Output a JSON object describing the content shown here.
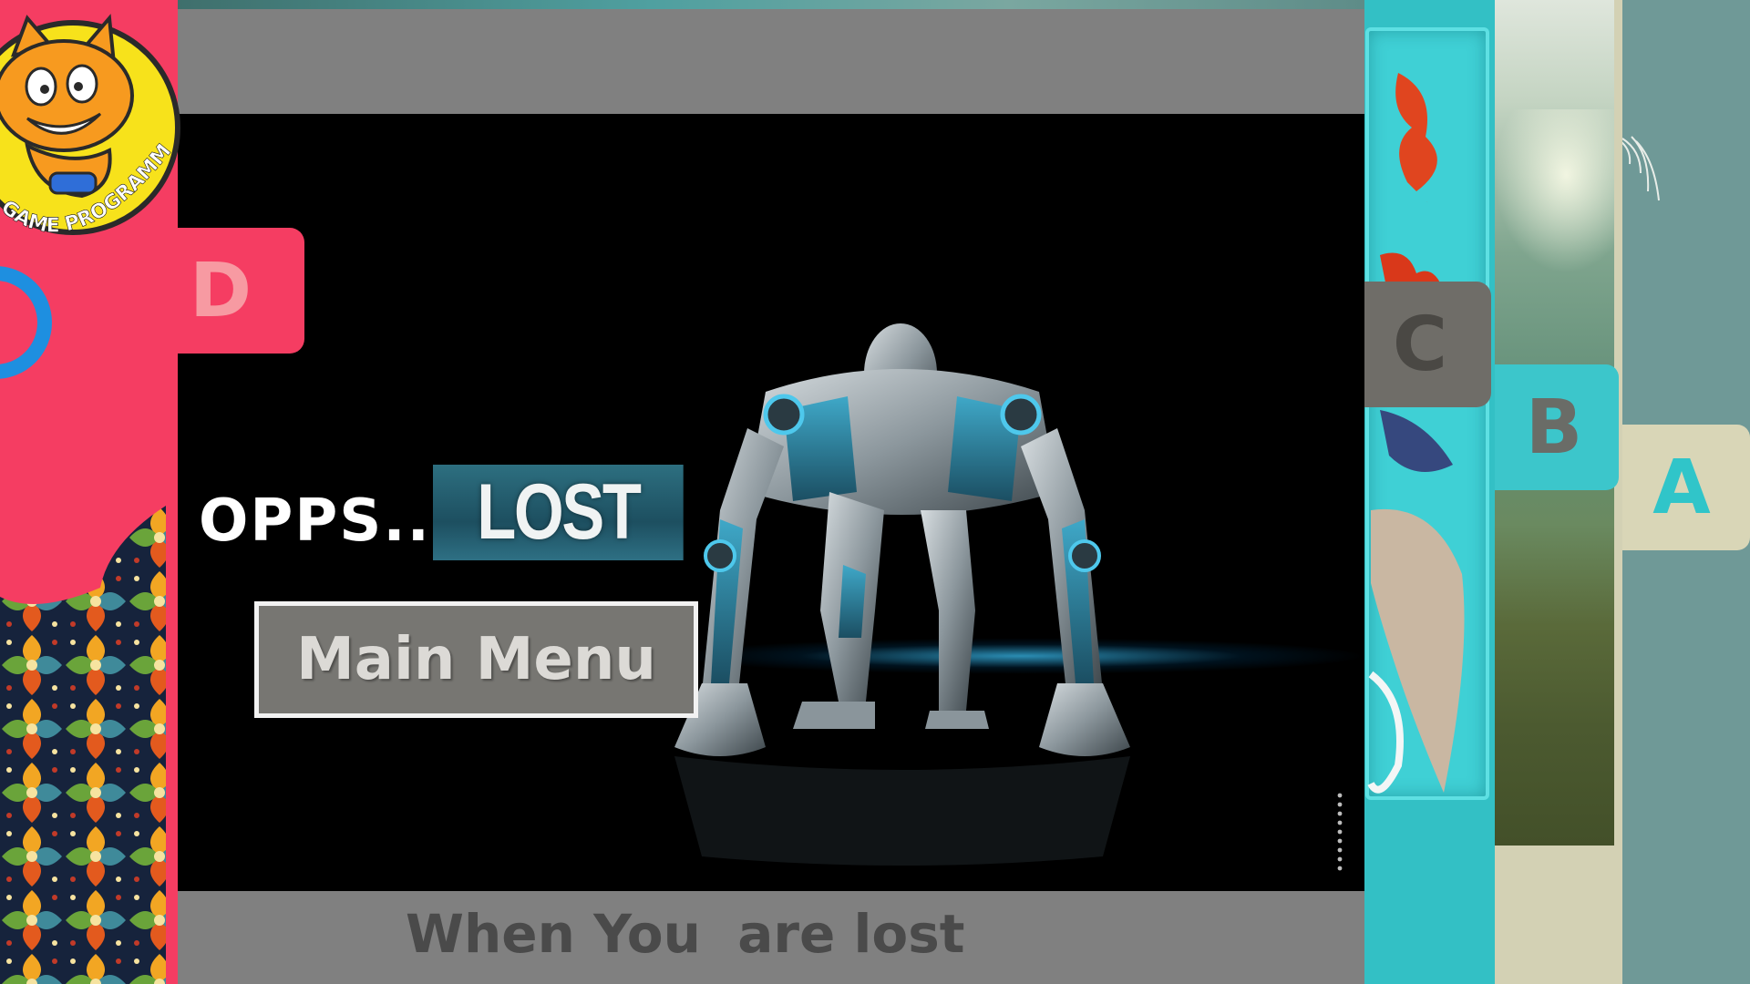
{
  "cards": {
    "a": {
      "tab_label": "A"
    },
    "b": {
      "tab_label": "B"
    },
    "c": {
      "tab_label": "C"
    },
    "d": {
      "tab_label": "D"
    }
  },
  "logo": {
    "text": "GAME PROGRAMMING",
    "icon": "scratch-cat-icon"
  },
  "slide": {
    "heading": "OPPS...",
    "badge": "LOST",
    "button_label": "Main Menu",
    "footer_caption": "When You  are lost"
  },
  "colors": {
    "card_a": "#6f9997",
    "card_b_tab": "#3cc6cb",
    "card_c": "#33c0c5",
    "card_c_tab": "#6f6d68",
    "card_d": "#f53d62",
    "slide_bg": "#000000",
    "slide_bars": "#808080",
    "button_bg": "#777672"
  }
}
